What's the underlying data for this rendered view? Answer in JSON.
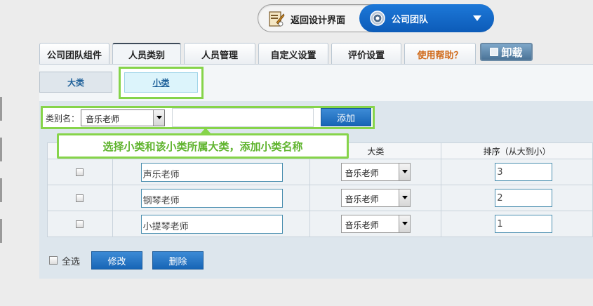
{
  "topbar": {
    "back_label": "返回设计界面",
    "company_label": "公司团队"
  },
  "tabs": [
    {
      "label": "公司团队组件",
      "active": false
    },
    {
      "label": "人员类别",
      "active": true
    },
    {
      "label": "人员管理",
      "active": false
    },
    {
      "label": "自定义设置",
      "active": false
    },
    {
      "label": "评价设置",
      "active": false
    },
    {
      "label": "使用帮助？",
      "active": false,
      "help": true
    }
  ],
  "unload_label": "卸载",
  "subtabs": {
    "big": "大类",
    "small": "小类"
  },
  "add_form": {
    "label": "类别名：",
    "selected": "音乐老师",
    "name_value": "",
    "add_label": "添加"
  },
  "tooltip": "选择小类和该小类所属大类，添加小类名称",
  "table": {
    "headers": [
      "",
      "",
      "大类",
      "排序（从大到小）"
    ],
    "rows": [
      {
        "name": "声乐老师",
        "category": "音乐老师",
        "order": "3"
      },
      {
        "name": "钢琴老师",
        "category": "音乐老师",
        "order": "2"
      },
      {
        "name": "小提琴老师",
        "category": "音乐老师",
        "order": "1"
      }
    ]
  },
  "bottom": {
    "select_all": "全选",
    "edit": "修改",
    "delete": "删除"
  },
  "colors": {
    "accent_blue": "#1765b6",
    "highlight_green": "#86d44a",
    "help_orange": "#d06a1a"
  }
}
